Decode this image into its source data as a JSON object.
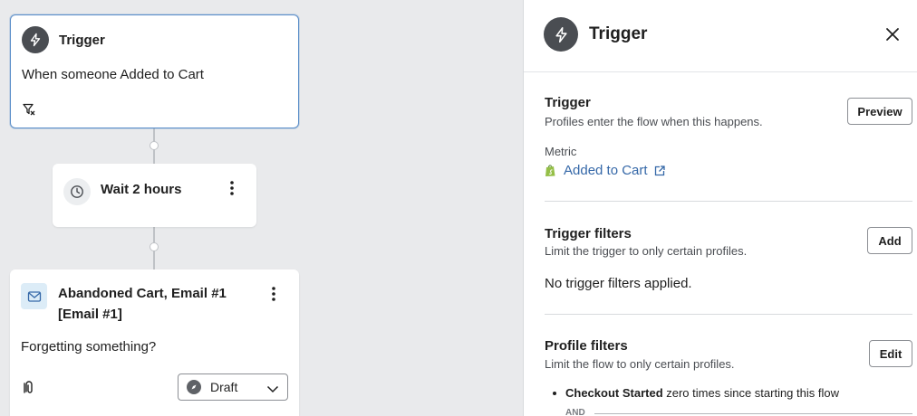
{
  "flow": {
    "trigger_card": {
      "title": "Trigger",
      "description": "When someone Added to Cart"
    },
    "wait_card": {
      "title": "Wait 2 hours"
    },
    "email_card": {
      "title_line1": "Abandoned Cart, Email #1",
      "title_line2": "[Email #1]",
      "subject": "Forgetting something?",
      "status": "Draft"
    }
  },
  "panel": {
    "title": "Trigger",
    "trigger_section": {
      "title": "Trigger",
      "subtitle": "Profiles enter the flow when this happens.",
      "button": "Preview",
      "metric_label": "Metric",
      "metric_value": "Added to Cart"
    },
    "trigger_filters": {
      "title": "Trigger filters",
      "subtitle": "Limit the trigger to only certain profiles.",
      "button": "Add",
      "empty_text": "No trigger filters applied."
    },
    "profile_filters": {
      "title": "Profile filters",
      "subtitle": "Limit the flow to only certain profiles.",
      "button": "Edit",
      "condition_bold": "Checkout Started",
      "condition_rest": " zero times since starting this flow",
      "joiner": "AND"
    }
  },
  "icons": {
    "trigger": "lightning-icon",
    "filter": "filter-icon",
    "wait": "clock-icon",
    "email": "envelope-icon",
    "smart-sending": "paperclip-icon",
    "status": "compass-icon",
    "close": "close-icon",
    "metric-source": "shopify-icon",
    "external": "external-link-icon"
  },
  "colors": {
    "accent": "#3568a8",
    "selected_border": "#5b8ec9",
    "canvas": "#e9eaec",
    "shopify": "#95bf47"
  }
}
